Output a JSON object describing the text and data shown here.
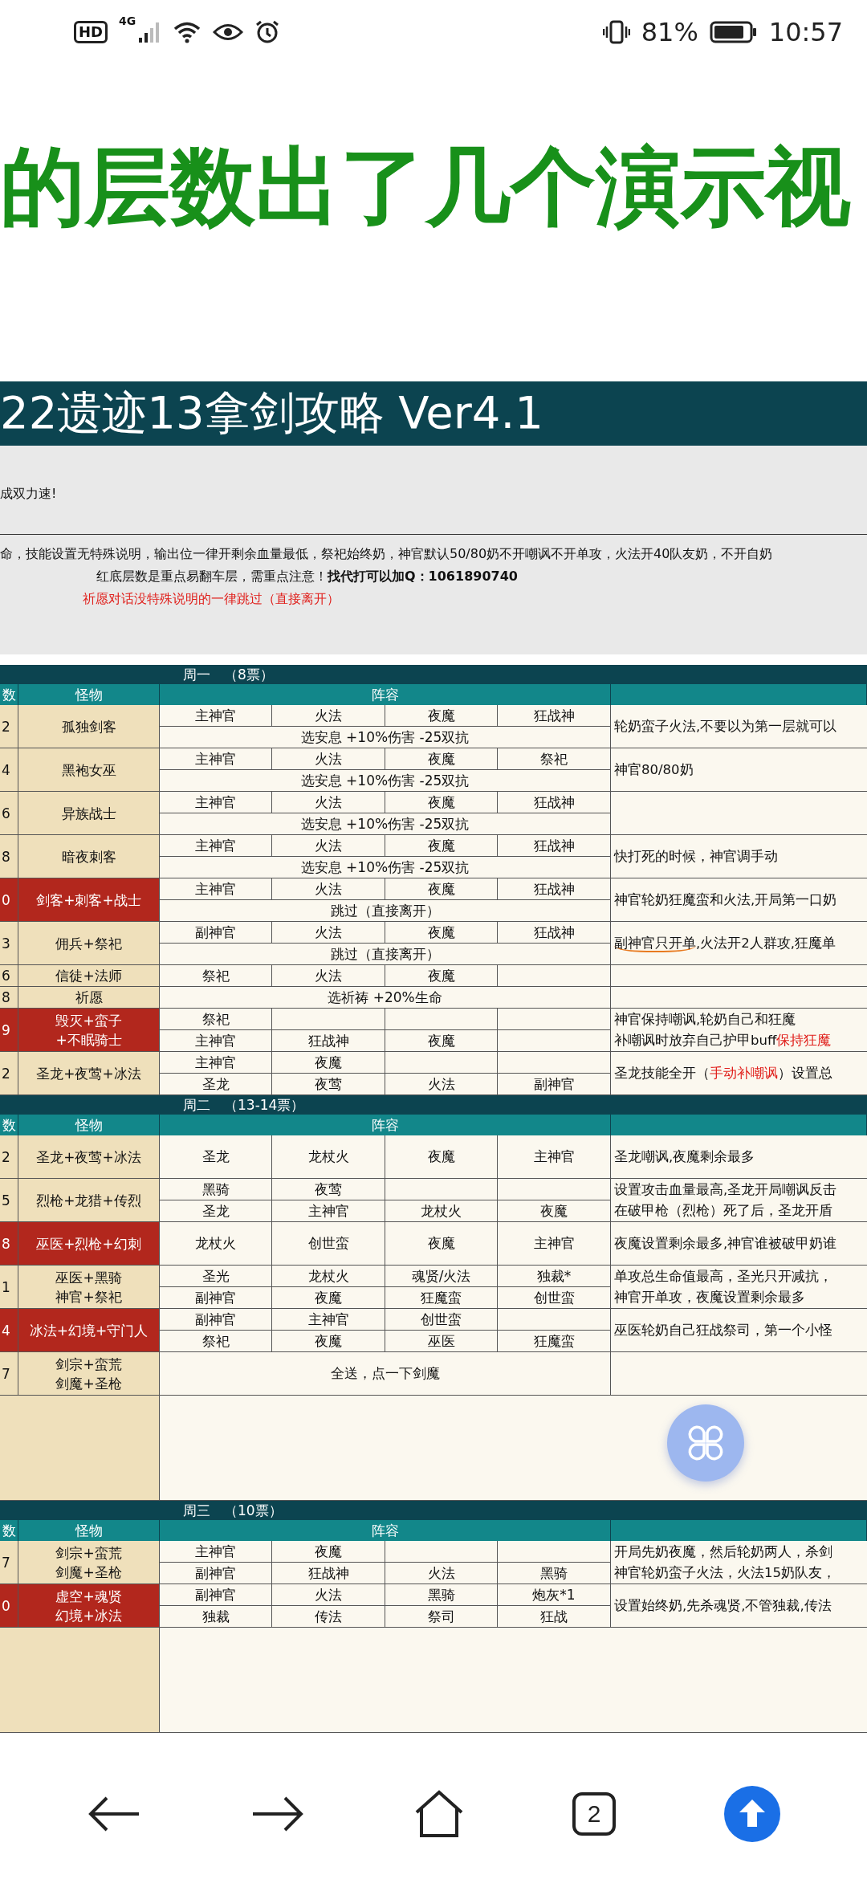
{
  "status_bar": {
    "hd": "HD",
    "network": "4G",
    "battery_text": "81%",
    "time": "10:57"
  },
  "banner": {
    "text": "的层数出了几个演示视"
  },
  "sheet": {
    "title": "22遗迹13拿剑攻略 Ver4.1",
    "intro": "成双力速!",
    "notes": [
      {
        "kind": "plain",
        "text": "命，技能设置无特殊说明，输出位一律开剩余血量最低，祭祀始终奶，神官默认50/80奶不开嘲讽不开单攻，火法开40队友奶，不开自奶"
      },
      {
        "kind": "indented",
        "text": "红底层数是重点易翻车层，需重点注意！**找代打可以加Q：1061890740**"
      },
      {
        "kind": "warning",
        "text": "祈愿对话没特殊说明的一律跳过（直接离开）"
      }
    ]
  },
  "weeks": [
    {
      "title": "周一　（8票）",
      "blank_area": false,
      "columns": [
        "数",
        "怪物",
        "阵容"
      ],
      "rows": [
        {
          "floor": "2",
          "monster": [
            "孤独剑客"
          ],
          "danger": false,
          "kind": "double",
          "lines": [
            {
              "cells": [
                "主神官",
                "火法",
                "夜魔",
                "狂战神"
              ]
            },
            {
              "text": "选安息 +10%伤害 -25双抗"
            }
          ],
          "notes": [
            [
              {
                "text": "轮奶蛮子火法,不要以为第一层就可以",
                "red": false,
                "underlined": false
              }
            ]
          ]
        },
        {
          "floor": "4",
          "monster": [
            "黑袍女巫"
          ],
          "danger": false,
          "kind": "double",
          "lines": [
            {
              "cells": [
                "主神官",
                "火法",
                "夜魔",
                "祭祀"
              ]
            },
            {
              "text": "选安息 +10%伤害 -25双抗"
            }
          ],
          "notes": [
            [
              {
                "text": "神官80/80奶",
                "red": false,
                "underlined": false
              }
            ]
          ]
        },
        {
          "floor": "6",
          "monster": [
            "异族战士"
          ],
          "danger": false,
          "kind": "double",
          "lines": [
            {
              "cells": [
                "主神官",
                "火法",
                "夜魔",
                "狂战神"
              ]
            },
            {
              "text": "选安息 +10%伤害 -25双抗"
            }
          ]
        },
        {
          "floor": "8",
          "monster": [
            "暗夜刺客"
          ],
          "danger": false,
          "kind": "double",
          "lines": [
            {
              "cells": [
                "主神官",
                "火法",
                "夜魔",
                "狂战神"
              ]
            },
            {
              "text": "选安息 +10%伤害 -25双抗"
            }
          ],
          "notes": [
            [
              {
                "text": "快打死的时候，神官调手动",
                "red": false,
                "underlined": false
              }
            ]
          ]
        },
        {
          "floor": "0",
          "monster": [
            "剑客+刺客+战士"
          ],
          "danger": true,
          "kind": "double",
          "lines": [
            {
              "cells": [
                "主神官",
                "火法",
                "夜魔",
                "狂战神"
              ]
            },
            {
              "text": "跳过（直接离开）"
            }
          ],
          "notes": [
            [
              {
                "text": "神官轮奶狂魔蛮和火法,开局第一口奶",
                "red": false,
                "underlined": false
              }
            ]
          ]
        },
        {
          "floor": "3",
          "monster": [
            "佣兵+祭祀"
          ],
          "danger": false,
          "kind": "double",
          "lines": [
            {
              "cells": [
                "副神官",
                "火法",
                "夜魔",
                "狂战神"
              ]
            },
            {
              "text": "跳过（直接离开）"
            }
          ],
          "notes": [
            [
              {
                "text": "副神官只开单",
                "red": false,
                "underlined": true
              },
              {
                "text": ",火法开2人群攻,狂魔单",
                "red": false,
                "underlined": false
              }
            ]
          ]
        },
        {
          "floor": "6",
          "monster": [
            "信徒+法师"
          ],
          "danger": false,
          "kind": "single",
          "lines": [
            {
              "cells": [
                "祭祀",
                "火法",
                "夜魔"
              ]
            }
          ]
        },
        {
          "floor": "8",
          "monster": [
            "祈愿"
          ],
          "danger": false,
          "kind": "single",
          "lines": [
            {
              "text": "选祈祷 +20%生命"
            }
          ]
        },
        {
          "floor": "9",
          "monster": [
            "毁灭+蛮子",
            "+不眠骑士"
          ],
          "danger": true,
          "kind": "double",
          "lines": [
            {
              "cells": [
                "祭祀"
              ]
            },
            {
              "cells": [
                "主神官",
                "狂战神",
                "夜魔"
              ]
            }
          ],
          "notes": [
            [
              {
                "text": "神官保持嘲讽,轮奶自己和狂魔",
                "red": false,
                "underlined": false
              }
            ],
            [
              {
                "text": "补嘲讽时放弃自己护甲buff",
                "red": false,
                "underlined": false
              },
              {
                "text": "保持狂魔",
                "red": true,
                "underlined": false
              }
            ]
          ]
        },
        {
          "floor": "2",
          "monster": [
            "圣龙+夜莺+冰法"
          ],
          "danger": false,
          "kind": "double",
          "lines": [
            {
              "cells": [
                "主神官",
                "夜魔"
              ]
            },
            {
              "cells": [
                "圣龙",
                "夜莺",
                "火法",
                "副神官"
              ]
            }
          ],
          "notes": [
            [
              {
                "text": "圣龙技能全开（",
                "red": false,
                "underlined": false
              },
              {
                "text": "手动补嘲讽",
                "red": true,
                "underlined": false
              },
              {
                "text": "）设置总",
                "red": false,
                "underlined": false
              }
            ]
          ]
        }
      ]
    },
    {
      "title": "周二　（13-14票）",
      "blank_area": true,
      "columns": [
        "数",
        "怪物",
        "阵容"
      ],
      "rows": [
        {
          "floor": "2",
          "monster": [
            "圣龙+夜莺+冰法"
          ],
          "danger": false,
          "kind": "double",
          "lines": [
            {
              "cells": [
                "圣龙",
                "龙杖火",
                "夜魔",
                "主神官"
              ]
            }
          ],
          "notes": [
            [
              {
                "text": "圣龙嘲讽,夜魔剩余最多",
                "red": false,
                "underlined": false
              }
            ]
          ]
        },
        {
          "floor": "5",
          "monster": [
            "烈枪+龙猎+传烈"
          ],
          "danger": false,
          "kind": "double",
          "lines": [
            {
              "cells": [
                "黑骑",
                "夜莺"
              ]
            },
            {
              "cells": [
                "圣龙",
                "主神官",
                "龙杖火",
                "夜魔"
              ]
            }
          ],
          "notes": [
            [
              {
                "text": "设置攻击血量最高,圣龙开局嘲讽反击",
                "red": false,
                "underlined": false
              }
            ],
            [
              {
                "text": "在破甲枪（烈枪）死了后，圣龙开盾",
                "red": false,
                "underlined": false
              }
            ]
          ]
        },
        {
          "floor": "8",
          "monster": [
            "巫医+烈枪+幻刺"
          ],
          "danger": true,
          "kind": "double",
          "lines": [
            {
              "cells": [
                "龙杖火",
                "创世蛮",
                "夜魔",
                "主神官"
              ]
            }
          ],
          "notes": [
            [
              {
                "text": "夜魔设置剩余最多,神官谁被破甲奶谁",
                "red": false,
                "underlined": false
              }
            ]
          ]
        },
        {
          "floor": "1",
          "monster": [
            "巫医+黑骑",
            "神官+祭祀"
          ],
          "danger": false,
          "kind": "double",
          "lines": [
            {
              "cells": [
                "圣光",
                "龙杖火",
                "魂贤/火法",
                "独裁*"
              ]
            },
            {
              "cells": [
                "副神官",
                "夜魔",
                "狂魔蛮",
                "创世蛮"
              ]
            }
          ],
          "notes": [
            [
              {
                "text": "单攻总生命值最高，圣光只开减抗，",
                "red": false,
                "underlined": false
              }
            ],
            [
              {
                "text": "神官开单攻，夜魔设置剩余最多",
                "red": false,
                "underlined": false
              }
            ]
          ]
        },
        {
          "floor": "4",
          "monster": [
            "冰法+幻境+守门人"
          ],
          "danger": true,
          "kind": "double",
          "lines": [
            {
              "cells": [
                "副神官",
                "主神官",
                "创世蛮"
              ]
            },
            {
              "cells": [
                "祭祀",
                "夜魔",
                "巫医",
                "狂魔蛮"
              ]
            }
          ],
          "notes": [
            [
              {
                "text": "巫医轮奶自己狂战祭司，第一个小怪",
                "red": false,
                "underlined": false
              }
            ]
          ]
        },
        {
          "floor": "7",
          "monster": [
            "剑宗+蛮荒",
            "剑魔+圣枪"
          ],
          "danger": false,
          "kind": "double",
          "lines": [
            {
              "text": "全送，点一下剑魔"
            }
          ]
        }
      ]
    },
    {
      "title": "周三　（10票）",
      "blank_area": true,
      "columns": [
        "数",
        "怪物",
        "阵容"
      ],
      "rows": [
        {
          "floor": "7",
          "monster": [
            "剑宗+蛮荒",
            "剑魔+圣枪"
          ],
          "danger": false,
          "kind": "double",
          "lines": [
            {
              "cells": [
                "主神官",
                "夜魔"
              ]
            },
            {
              "cells": [
                "副神官",
                "狂战神",
                "火法",
                "黑骑"
              ]
            }
          ],
          "notes": [
            [
              {
                "text": "开局先奶夜魔，然后轮奶两人，杀剑",
                "red": false,
                "underlined": false
              }
            ],
            [
              {
                "text": "神官轮奶蛮子火法，火法15奶队友，",
                "red": false,
                "underlined": false
              }
            ]
          ]
        },
        {
          "floor": "0",
          "monster": [
            "虚空+魂贤",
            "幻境+冰法"
          ],
          "danger": true,
          "kind": "double",
          "lines": [
            {
              "cells": [
                "副神官",
                "火法",
                "黑骑",
                "炮灰*1"
              ]
            },
            {
              "cells": [
                "独裁",
                "传法",
                "祭司",
                "狂战"
              ]
            }
          ],
          "notes": [
            [
              {
                "text": "设置始终奶,先杀魂贤,不管独裁,传法",
                "red": false,
                "underlined": false
              }
            ]
          ]
        }
      ]
    }
  ],
  "nav_bar": {
    "tab_count": "2"
  }
}
